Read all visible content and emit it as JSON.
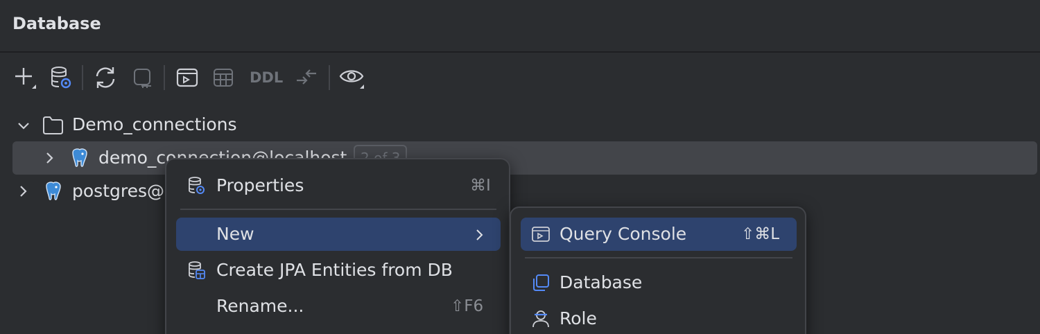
{
  "panel": {
    "title": "Database"
  },
  "toolbar": {
    "buttons": [
      {
        "name": "add-icon"
      },
      {
        "name": "data-source-properties-icon"
      },
      {
        "name": "refresh-icon"
      },
      {
        "name": "disconnect-icon"
      },
      {
        "name": "query-console-icon"
      },
      {
        "name": "table-icon"
      },
      {
        "name": "compare-icon"
      },
      {
        "name": "view-options-icon"
      }
    ],
    "ddl_label": "DDL"
  },
  "tree": {
    "folder": {
      "label": "Demo_connections",
      "icon": "folder-icon"
    },
    "connection": {
      "label": "demo_connection@localhost",
      "badge": "2 of 3",
      "icon": "postgresql-elephant-icon"
    },
    "postgres": {
      "label": "postgres@",
      "icon": "postgresql-elephant-icon"
    }
  },
  "context_menu": {
    "items": [
      {
        "label": "Properties",
        "shortcut": "⌘I",
        "icon": "data-source-properties-icon"
      },
      {
        "label": "New",
        "shortcut": "›"
      },
      {
        "label": "Create JPA Entities from DB",
        "shortcut": "",
        "icon": "jpa-entities-icon"
      },
      {
        "label": "Rename...",
        "shortcut": "⇧F6"
      }
    ]
  },
  "submenu": {
    "items": [
      {
        "label": "Query Console",
        "shortcut": "⇧⌘L",
        "icon": "query-console-icon"
      },
      {
        "label": "Database",
        "icon": "database-copy-icon"
      },
      {
        "label": "Role",
        "icon": "role-user-icon"
      }
    ]
  },
  "colors": {
    "background": "#2b2d30",
    "selection": "#43454a",
    "menu_highlight": "#2e436e",
    "accent": "#548af7"
  }
}
